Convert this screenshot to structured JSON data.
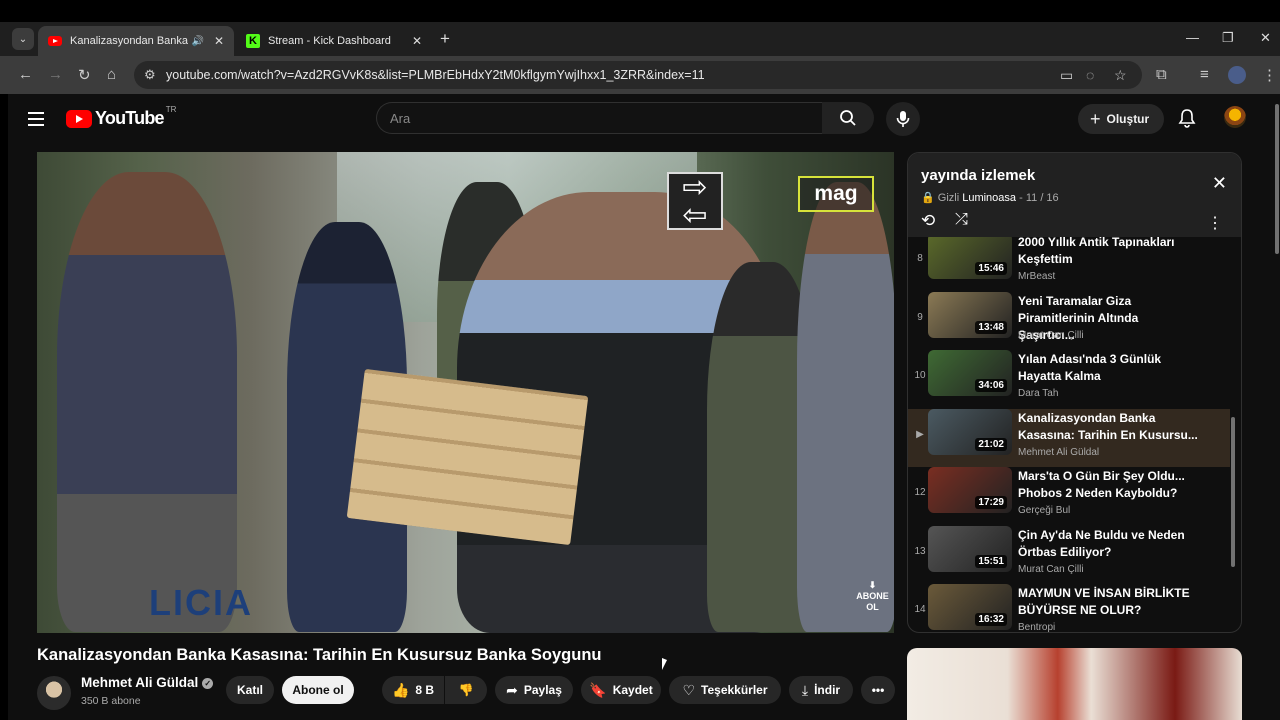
{
  "browser": {
    "tabs": [
      {
        "title": "Kanalizasyondan Banka Kas",
        "active": true
      },
      {
        "title": "Stream - Kick Dashboard",
        "active": false
      }
    ],
    "url": "youtube.com/watch?v=Azd2RGVvK8s&list=PLMBrEbHdxY2tM0kflgymYwjIhxx1_3ZRR&index=11"
  },
  "header": {
    "logo_text": "YouTube",
    "region": "TR",
    "search_placeholder": "Ara",
    "create_label": "Oluştur"
  },
  "video": {
    "title": "Kanalizasyondan Banka Kasasına: Tarihin En Kusursuz Banka Soygunu",
    "watermark": "mag",
    "subscribe_watermark": "ABONE OL",
    "channel": "Mehmet Ali Güldal",
    "subscribers": "350 B abone",
    "actions": {
      "join": "Katıl",
      "subscribe": "Abone ol",
      "likes": "8 B",
      "share": "Paylaş",
      "save": "Kaydet",
      "thanks": "Teşekkürler",
      "download": "İndir"
    }
  },
  "playlist": {
    "title": "yayında izlemek",
    "privacy": "Gizli",
    "owner": "Luminoasa",
    "position": "11 / 16",
    "items": [
      {
        "index": "8",
        "title": "2000 Yıllık Antik Tapınakları Keşfettim",
        "channel": "MrBeast",
        "duration": "15:46",
        "thumb": "#5b6a2a"
      },
      {
        "index": "9",
        "title": "Yeni Taramalar Giza Piramitlerinin Altında Şaşırtıcı...",
        "channel": "Murat Can Çilli",
        "duration": "13:48",
        "thumb": "#8b7a55"
      },
      {
        "index": "10",
        "title": "Yılan Adası'nda 3 Günlük Hayatta Kalma",
        "channel": "Dara Tah",
        "duration": "34:06",
        "thumb": "#3f6a34"
      },
      {
        "index": "",
        "title": "Kanalizasyondan Banka Kasasına: Tarihin En Kusursu...",
        "channel": "Mehmet Ali Güldal",
        "duration": "21:02",
        "thumb": "#4b5a62",
        "current": true
      },
      {
        "index": "12",
        "title": "Mars'ta O Gün Bir Şey Oldu... Phobos 2 Neden Kayboldu?",
        "channel": "Gerçeği Bul",
        "duration": "17:29",
        "thumb": "#7a2e22"
      },
      {
        "index": "13",
        "title": "Çin Ay'da Ne Buldu ve Neden Örtbas Ediliyor?",
        "channel": "Murat Can Çilli",
        "duration": "15:51",
        "thumb": "#555555"
      },
      {
        "index": "14",
        "title": "MAYMUN VE İNSAN BİRLİKTE BÜYÜRSE NE OLUR?",
        "channel": "Bentropi",
        "duration": "16:32",
        "thumb": "#6b5a3a"
      }
    ]
  }
}
